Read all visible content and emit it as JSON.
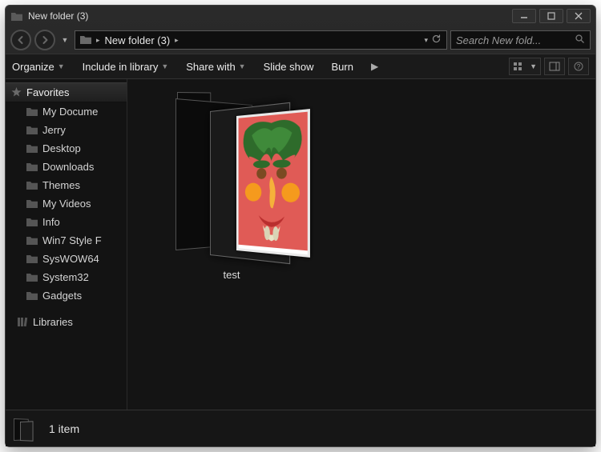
{
  "window": {
    "title": "New folder (3)"
  },
  "nav": {
    "breadcrumb": "New folder (3)",
    "search_placeholder": "Search New fold..."
  },
  "toolbar": {
    "organize": "Organize",
    "include": "Include in library",
    "share": "Share with",
    "slideshow": "Slide show",
    "burn": "Burn"
  },
  "sidebar": {
    "favorites_header": "Favorites",
    "items": [
      {
        "label": "My Docume"
      },
      {
        "label": "Jerry"
      },
      {
        "label": "Desktop"
      },
      {
        "label": "Downloads"
      },
      {
        "label": "Themes"
      },
      {
        "label": "My Videos"
      },
      {
        "label": "Info"
      },
      {
        "label": "Win7 Style F"
      },
      {
        "label": "SysWOW64"
      },
      {
        "label": "System32"
      },
      {
        "label": "Gadgets"
      }
    ],
    "libraries": "Libraries"
  },
  "content": {
    "items": [
      {
        "label": "test",
        "thumb_bg": "#e05b56"
      }
    ]
  },
  "status": {
    "count_text": "1 item"
  }
}
